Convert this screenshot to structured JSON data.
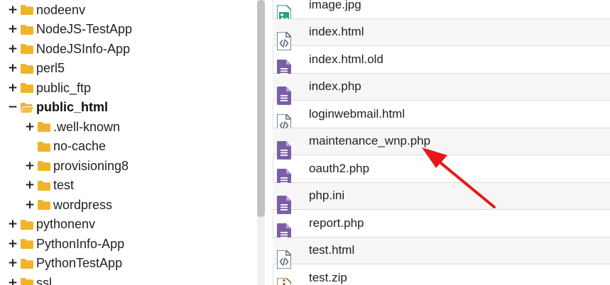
{
  "tree": {
    "items": [
      {
        "label": "nodeenv",
        "toggle": "+",
        "depth": 0,
        "bold": false
      },
      {
        "label": "NodeJS-TestApp",
        "toggle": "+",
        "depth": 0,
        "bold": false
      },
      {
        "label": "NodeJSInfo-App",
        "toggle": "+",
        "depth": 0,
        "bold": false
      },
      {
        "label": "perl5",
        "toggle": "+",
        "depth": 0,
        "bold": false
      },
      {
        "label": "public_ftp",
        "toggle": "+",
        "depth": 0,
        "bold": false
      },
      {
        "label": "public_html",
        "toggle": "−",
        "depth": 0,
        "bold": true,
        "open": true
      },
      {
        "label": ".well-known",
        "toggle": "+",
        "depth": 1,
        "bold": false
      },
      {
        "label": "no-cache",
        "toggle": "",
        "depth": 1,
        "bold": false
      },
      {
        "label": "provisioning8",
        "toggle": "+",
        "depth": 1,
        "bold": false
      },
      {
        "label": "test",
        "toggle": "+",
        "depth": 1,
        "bold": false
      },
      {
        "label": "wordpress",
        "toggle": "+",
        "depth": 1,
        "bold": false
      },
      {
        "label": "pythonenv",
        "toggle": "+",
        "depth": 0,
        "bold": false
      },
      {
        "label": "PythonInfo-App",
        "toggle": "+",
        "depth": 0,
        "bold": false
      },
      {
        "label": "PythonTestApp",
        "toggle": "+",
        "depth": 0,
        "bold": false
      },
      {
        "label": "ssl",
        "toggle": "+",
        "depth": 0,
        "bold": false
      }
    ]
  },
  "files": {
    "items": [
      {
        "name": "image.jpg",
        "icon": "image-file-icon"
      },
      {
        "name": "index.html",
        "icon": "code-file-icon"
      },
      {
        "name": "index.html.old",
        "icon": "text-file-icon"
      },
      {
        "name": "index.php",
        "icon": "text-file-icon"
      },
      {
        "name": "loginwebmail.html",
        "icon": "code-file-icon"
      },
      {
        "name": "maintenance_wnp.php",
        "icon": "text-file-icon"
      },
      {
        "name": "oauth2.php",
        "icon": "text-file-icon"
      },
      {
        "name": "php.ini",
        "icon": "text-file-icon"
      },
      {
        "name": "report.php",
        "icon": "text-file-icon"
      },
      {
        "name": "test.html",
        "icon": "code-file-icon"
      },
      {
        "name": "test.zip",
        "icon": "zip-file-icon"
      }
    ]
  },
  "colors": {
    "folder": "#f0b429",
    "text_file": "#7b5ea7",
    "code_file": "#5b6b7c",
    "image_file": "#2e9e88",
    "zip_file": "#9a6a2e",
    "arrow": "#e81818"
  }
}
